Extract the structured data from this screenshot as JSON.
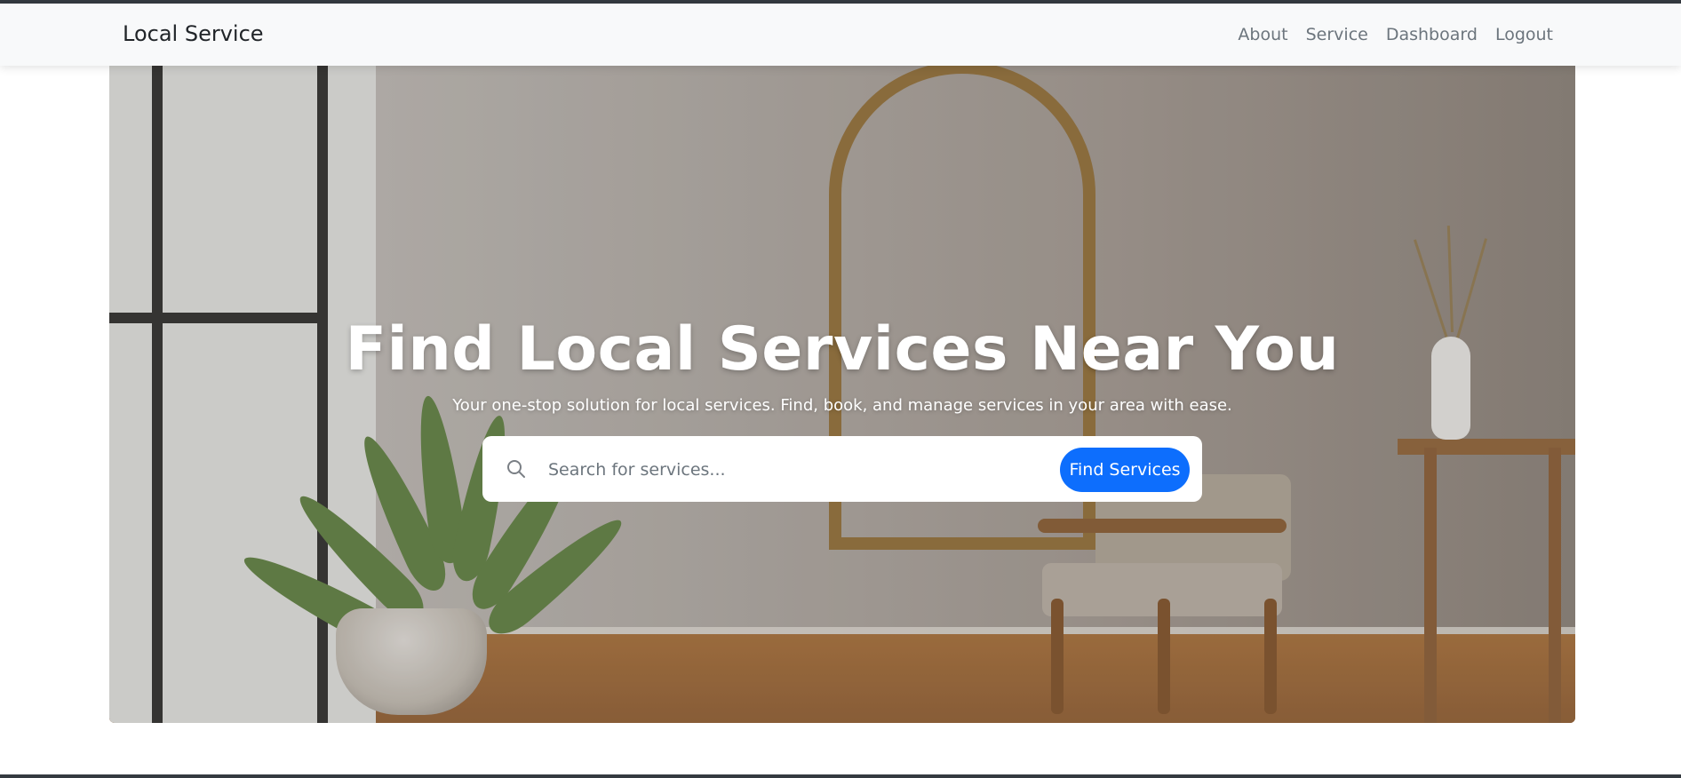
{
  "navbar": {
    "brand": "Local Service",
    "links": [
      {
        "label": "About"
      },
      {
        "label": "Service"
      },
      {
        "label": "Dashboard"
      },
      {
        "label": "Logout"
      }
    ]
  },
  "hero": {
    "title": "Find Local Services Near You",
    "subtitle": "Your one-stop solution for local services. Find, book, and manage services in your area with ease.",
    "search": {
      "icon": "search-icon",
      "placeholder": "Search for services...",
      "value": "",
      "button_label": "Find Services"
    },
    "background_image": "room-interior-image"
  },
  "colors": {
    "primary": "#0d6efd",
    "navbar_bg": "#f8f9fa",
    "nav_text": "#6c757d",
    "brand_text": "#212529",
    "hero_text": "#ffffff"
  }
}
